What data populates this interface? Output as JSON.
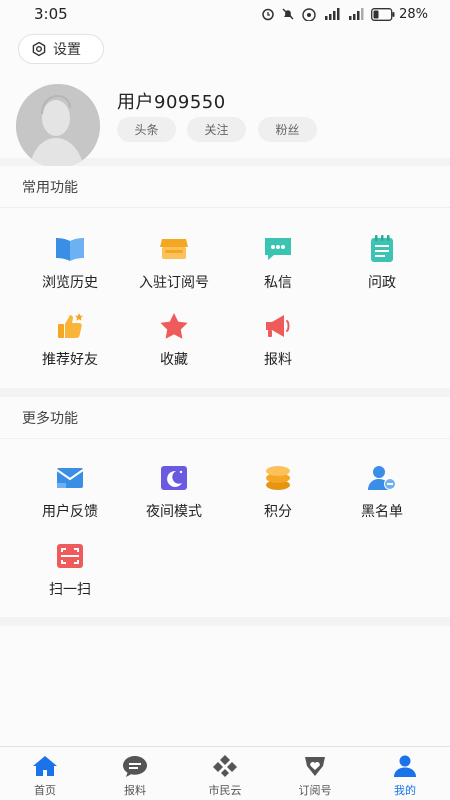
{
  "status_bar": {
    "time": "3:05",
    "battery_percent": "28%"
  },
  "profile": {
    "settings_label": "设置",
    "username": "用户909550",
    "pills": [
      "头条",
      "关注",
      "粉丝"
    ]
  },
  "common_functions": {
    "title": "常用功能",
    "items": [
      {
        "label": "浏览历史",
        "icon": "book-icon"
      },
      {
        "label": "入驻订阅号",
        "icon": "storefront-icon"
      },
      {
        "label": "私信",
        "icon": "message-icon"
      },
      {
        "label": "问政",
        "icon": "notepad-icon"
      },
      {
        "label": "推荐好友",
        "icon": "thumbs-up-icon"
      },
      {
        "label": "收藏",
        "icon": "star-icon"
      },
      {
        "label": "报料",
        "icon": "megaphone-icon"
      }
    ]
  },
  "more_functions": {
    "title": "更多功能",
    "items": [
      {
        "label": "用户反馈",
        "icon": "feedback-icon"
      },
      {
        "label": "夜间模式",
        "icon": "moon-icon"
      },
      {
        "label": "积分",
        "icon": "coins-icon"
      },
      {
        "label": "黑名单",
        "icon": "blacklist-user-icon"
      },
      {
        "label": "扫一扫",
        "icon": "scan-icon"
      }
    ]
  },
  "tabbar": {
    "active": "我的",
    "tabs": [
      {
        "label": "首页",
        "icon": "home-icon"
      },
      {
        "label": "报料",
        "icon": "report-bubble-icon"
      },
      {
        "label": "市民云",
        "icon": "diamond-cluster-icon"
      },
      {
        "label": "订阅号",
        "icon": "heart-badge-icon"
      },
      {
        "label": "我的",
        "icon": "person-icon"
      }
    ]
  },
  "colors": {
    "accent": "#1a73e8",
    "blue_icon": "#3a8ee6",
    "orange_icon": "#f5a623",
    "teal_icon": "#3cc4b3",
    "red_icon": "#ef5b5b"
  }
}
